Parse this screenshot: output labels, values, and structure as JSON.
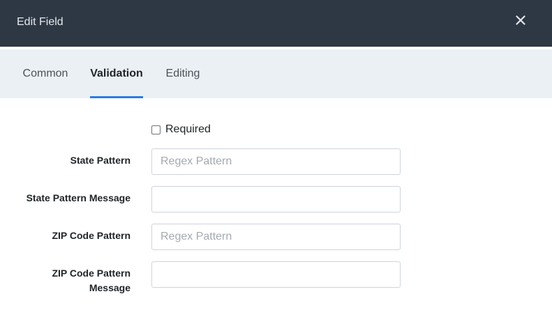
{
  "dialog": {
    "title": "Edit Field",
    "close_icon": "close-icon"
  },
  "tabs": [
    {
      "label": "Common",
      "active": false
    },
    {
      "label": "Validation",
      "active": true
    },
    {
      "label": "Editing",
      "active": false
    }
  ],
  "form": {
    "required": {
      "label": "Required",
      "checked": false
    },
    "fields": [
      {
        "label": "State Pattern",
        "value": "",
        "placeholder": "Regex Pattern"
      },
      {
        "label": "State Pattern Message",
        "value": "",
        "placeholder": ""
      },
      {
        "label": "ZIP Code Pattern",
        "value": "",
        "placeholder": "Regex Pattern"
      },
      {
        "label": "ZIP Code Pattern Message",
        "value": "",
        "placeholder": ""
      }
    ]
  },
  "colors": {
    "header_bg": "#2e3844",
    "tabs_bg": "#ebf0f4",
    "accent": "#2a7be4"
  }
}
